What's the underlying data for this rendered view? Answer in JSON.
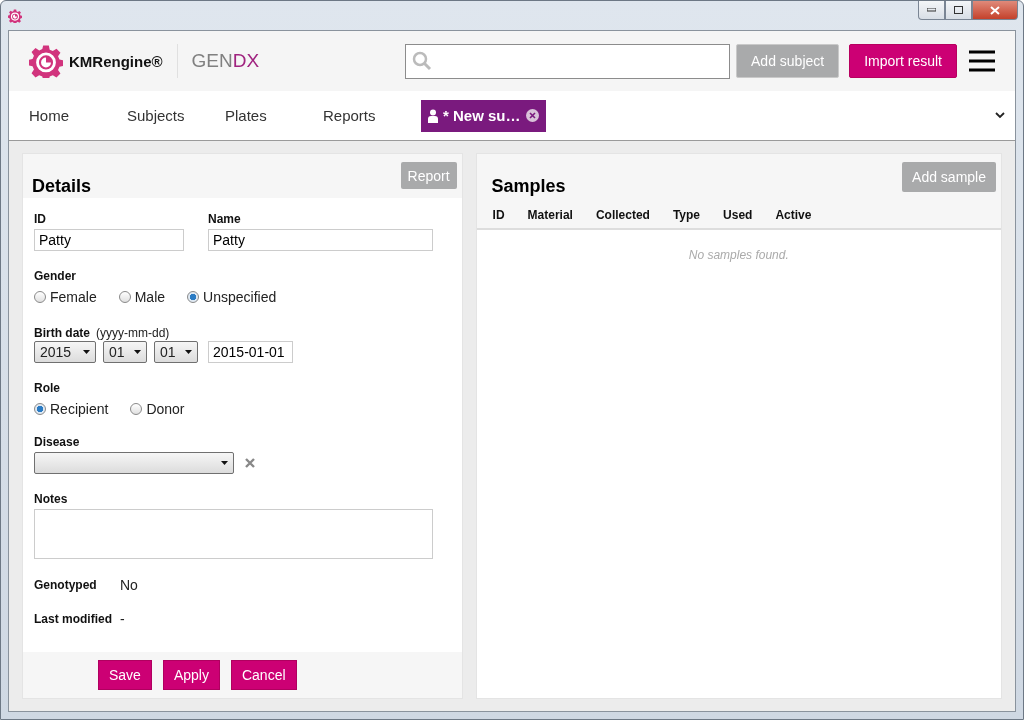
{
  "header": {
    "brand": "KMRengine®",
    "product": [
      {
        "text": "GEN",
        "accent": false
      },
      {
        "text": "DX",
        "accent": true
      }
    ],
    "buttons": [
      {
        "label": "Add subject",
        "disabled": true
      },
      {
        "label": "Import result",
        "disabled": false
      }
    ]
  },
  "tabs": [
    {
      "label": "Home",
      "selected": false,
      "kind": "link"
    },
    {
      "label": "Subjects",
      "selected": false,
      "kind": "link"
    },
    {
      "label": "Plates",
      "selected": false,
      "kind": "link"
    },
    {
      "label": "Reports",
      "selected": false,
      "kind": "link"
    },
    {
      "label": "* New su…",
      "selected": true,
      "kind": "document"
    }
  ],
  "details": {
    "title": "Details",
    "report_button": {
      "label": "Report",
      "disabled": true
    },
    "id": {
      "label": "ID",
      "value": "Patty"
    },
    "name": {
      "label": "Name",
      "value": "Patty"
    },
    "gender": {
      "label": "Gender",
      "options": [
        {
          "label": "Female",
          "selected": false
        },
        {
          "label": "Male",
          "selected": false
        },
        {
          "label": "Unspecified",
          "selected": true
        }
      ]
    },
    "birth_date": {
      "label": "Birth date",
      "hint": "(yyyy-mm-dd)",
      "selects": [
        "2015",
        "01",
        "01"
      ],
      "value": "2015-01-01"
    },
    "role": {
      "label": "Role",
      "options": [
        {
          "label": "Recipient",
          "selected": true
        },
        {
          "label": "Donor",
          "selected": false
        }
      ]
    },
    "disease": {
      "label": "Disease"
    },
    "notes": {
      "label": "Notes"
    },
    "info": [
      {
        "label": "Genotyped",
        "value": "No"
      },
      {
        "label": "Last modified",
        "value": "-"
      }
    ],
    "actions": [
      "Save",
      "Apply",
      "Cancel"
    ]
  },
  "samples": {
    "title": "Samples",
    "add_button": {
      "label": "Add sample",
      "disabled": true
    },
    "columns": [
      "ID",
      "Material",
      "Collected",
      "Type",
      "Used",
      "Active"
    ],
    "empty_message": "No samples found."
  }
}
